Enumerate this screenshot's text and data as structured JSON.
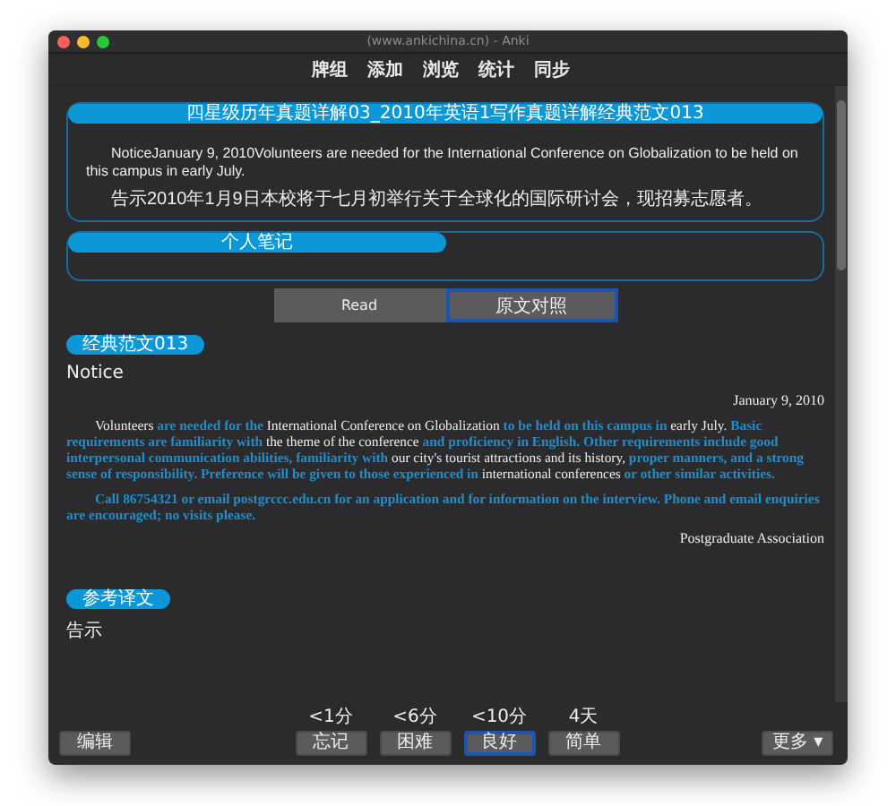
{
  "window": {
    "title": "(www.ankichina.cn)  - Anki"
  },
  "toolbar": [
    "牌组",
    "添加",
    "浏览",
    "统计",
    "同步"
  ],
  "card": {
    "title": "四星级历年真题详解03_2010年英语1写作真题详解经典范文013",
    "paragraphs": [
      "NoticeJanuary 9, 2010Volunteers are needed for the International Conference on Globalization to be held on this campus in early July.",
      "告示2010年1月9日本校将于七月初举行关于全球化的国际研讨会，现招募志愿者。"
    ]
  },
  "notes": {
    "title": "个人笔记"
  },
  "view_buttons": [
    {
      "label": "Read",
      "selected": false
    },
    {
      "label": "原文对照",
      "selected": true
    }
  ],
  "essay": {
    "tag": "经典范文013",
    "heading": "Notice",
    "date": "January 9, 2010",
    "paragraphs": [
      "Volunteers **are needed for the** International Conference on Globalization **to be held on this campus in** early July. **Basic requirements are familiarity with** the theme of the conference **and proficiency in English. Other requirements include good interpersonal communication abilities, familiarity with** our city's tourist attractions and its history, **proper manners, and a strong sense of responsibility. Preference will be given to those experienced in** international conferences **or other similar activities.**",
      "**Call 86754321 or email postgrccc.edu.cn for an application and for information on the interview. Phone and email enquiries are encouraged; no visits please.**"
    ],
    "signature": "Postgraduate Association"
  },
  "translation": {
    "tag": "参考译文",
    "text": "告示"
  },
  "bottom": {
    "edit": "编辑",
    "more": "更多 ▾",
    "answers": [
      {
        "time": "<1分",
        "label": "忘记",
        "selected": false
      },
      {
        "time": "<6分",
        "label": "困难",
        "selected": false
      },
      {
        "time": "<10分",
        "label": "良好",
        "selected": true
      },
      {
        "time": "4天",
        "label": "简单",
        "selected": false
      }
    ]
  }
}
